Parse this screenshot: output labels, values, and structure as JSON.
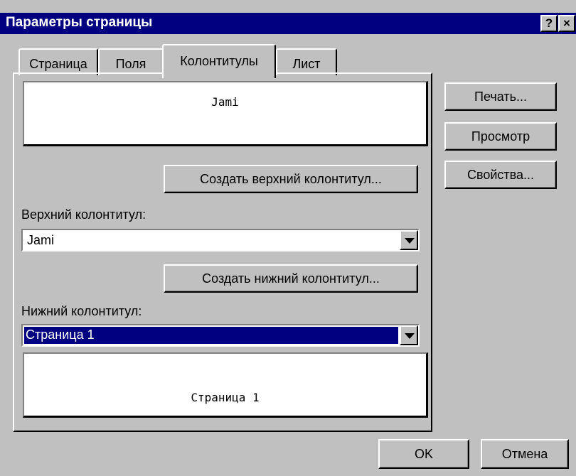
{
  "window": {
    "title": "Параметры страницы",
    "help_label": "?",
    "close_label": "×"
  },
  "tabs": [
    {
      "label": "Страница",
      "active": false
    },
    {
      "label": "Поля",
      "active": false
    },
    {
      "label": "Колонтитулы",
      "active": true
    },
    {
      "label": "Лист",
      "active": false
    }
  ],
  "header": {
    "preview_text": "Jami",
    "create_button": "Создать верхний колонтитул...",
    "label": "Верхний колонтитул:",
    "value": "Jami"
  },
  "footer": {
    "create_button": "Создать нижний колонтитул...",
    "label": "Нижний колонтитул:",
    "value": "Страница 1",
    "preview_text": "Страница 1"
  },
  "side_buttons": {
    "print": "Печать...",
    "preview": "Просмотр",
    "properties": "Свойства..."
  },
  "bottom_buttons": {
    "ok": "OK",
    "cancel": "Отмена"
  },
  "colors": {
    "dialog_bg": "#c0c0c0",
    "titlebar": "#000080",
    "selection": "#000080"
  }
}
